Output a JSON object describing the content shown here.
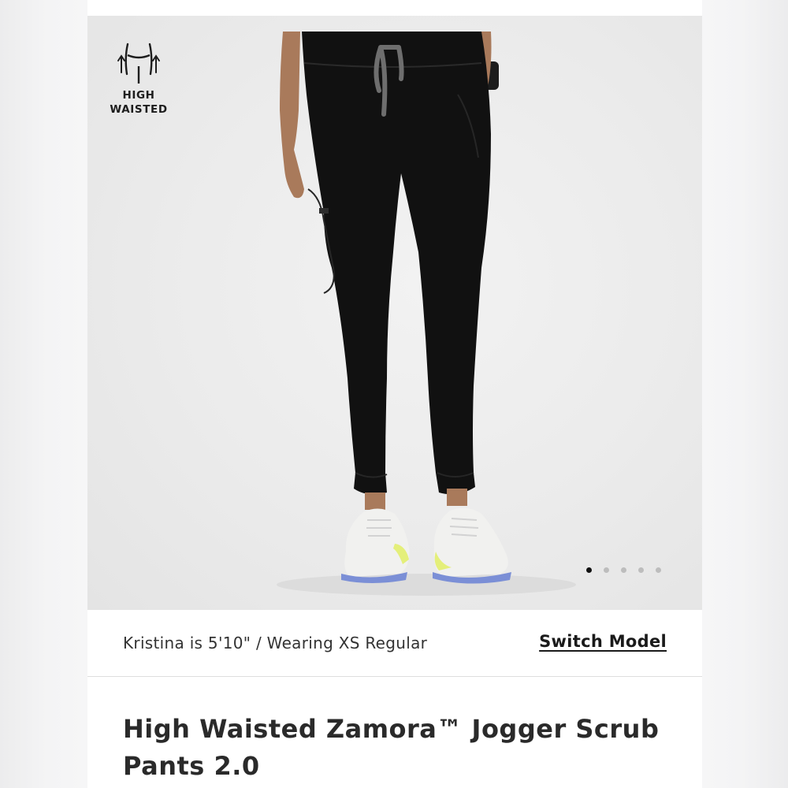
{
  "badge": {
    "icon": "high-waist-icon",
    "line1": "HIGH",
    "line2": "WAISTED"
  },
  "carousel": {
    "total": 5,
    "active_index": 0
  },
  "model": {
    "info": "Kristina is 5'10\" / Wearing XS Regular",
    "switch_label": "Switch Model"
  },
  "product": {
    "title": "High Waisted Zamora™ Jogger Scrub Pants 2.0"
  },
  "colors": {
    "pants": "#111111",
    "background": "#ebebeb",
    "drawstring": "#6e6e6e",
    "sneaker_sole": "#7b8fd6",
    "sneaker_accent": "#e4ef7a"
  }
}
